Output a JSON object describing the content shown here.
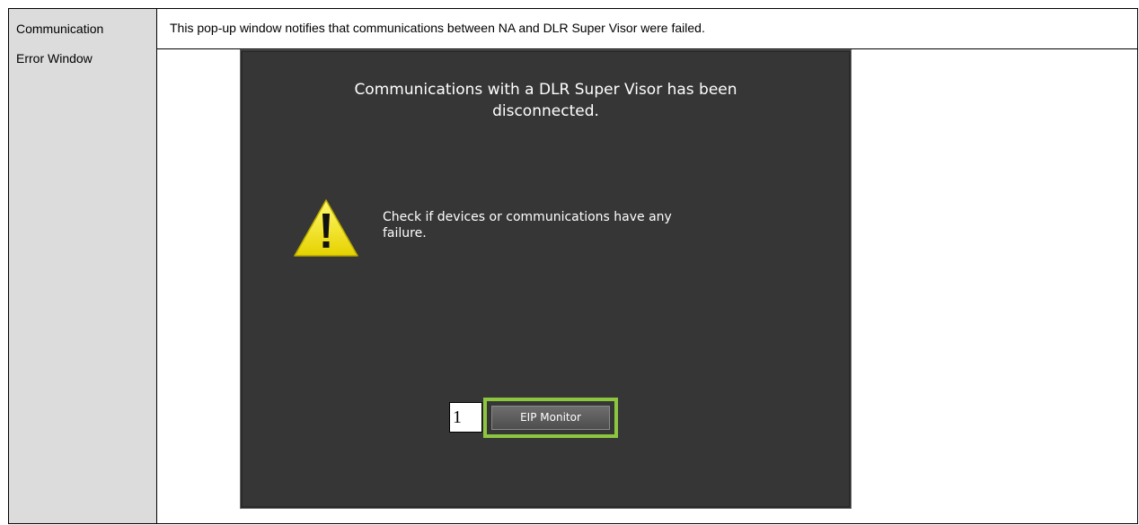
{
  "table": {
    "label_line1": "Communication",
    "label_line2": "Error Window",
    "description": "This pop-up window notifies that communications between NA and DLR Super Visor were failed."
  },
  "popup": {
    "title_line1": "Communications with a DLR Super Visor has been",
    "title_line2": "disconnected.",
    "message_line1": "Check if devices or communications have any",
    "message_line2": "failure.",
    "icon": "warning-icon",
    "button_label": "EIP Monitor",
    "callout_number": "1"
  },
  "colors": {
    "popup_bg": "#363636",
    "highlight": "#8cc63f",
    "warning_yellow": "#f2e600",
    "label_cell_bg": "#dcdcdc"
  }
}
